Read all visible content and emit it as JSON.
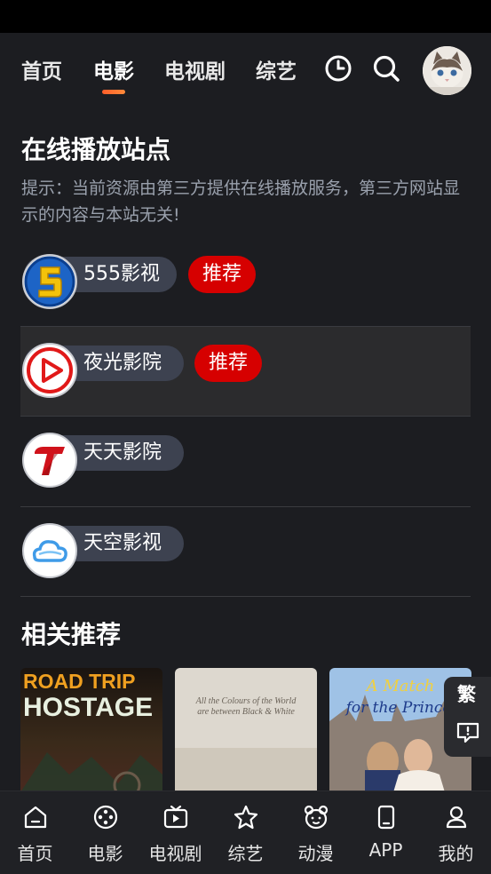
{
  "nav": {
    "tabs": [
      {
        "label": "首页",
        "active": false
      },
      {
        "label": "电影",
        "active": true
      },
      {
        "label": "电视剧",
        "active": false
      },
      {
        "label": "综艺",
        "active": false
      }
    ],
    "icons": [
      "history-icon",
      "search-icon"
    ],
    "avatar": "avatar-cat"
  },
  "online": {
    "title": "在线播放站点",
    "hint": "提示：当前资源由第三方提供在线播放服务，第三方网站显示的内容与本站无关!",
    "sites": [
      {
        "name": "555影视",
        "badge": "推荐",
        "logo": "s5-logo"
      },
      {
        "name": "夜光影院",
        "badge": "推荐",
        "logo": "play-logo"
      },
      {
        "name": "天天影院",
        "badge": "",
        "logo": "t-logo"
      },
      {
        "name": "天空影视",
        "badge": "",
        "logo": "cloud-logo"
      }
    ]
  },
  "related": {
    "title": "相关推荐",
    "posters": [
      {
        "title_line1": "ROAD TRIP",
        "title_line2": "HOSTAGE"
      },
      {
        "title_line1": "All the Colours of the World",
        "title_line2": "are between Black & White"
      },
      {
        "title_line1": "A Match",
        "title_line2": "for the Prince"
      }
    ]
  },
  "side_tools": {
    "traditional": "繁",
    "feedback_icon": "message-icon"
  },
  "bottom_nav": [
    {
      "label": "首页",
      "icon": "home-icon"
    },
    {
      "label": "电影",
      "icon": "film-reel-icon"
    },
    {
      "label": "电视剧",
      "icon": "tv-icon"
    },
    {
      "label": "综艺",
      "icon": "star-icon"
    },
    {
      "label": "动漫",
      "icon": "bear-icon"
    },
    {
      "label": "APP",
      "icon": "phone-icon"
    },
    {
      "label": "我的",
      "icon": "user-icon"
    }
  ]
}
